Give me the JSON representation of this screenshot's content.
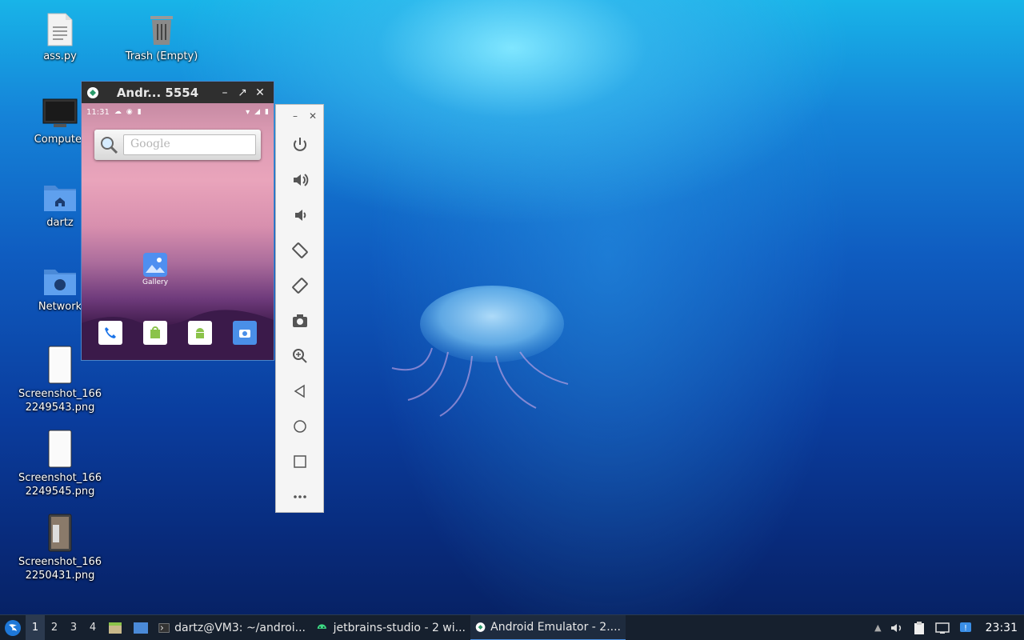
{
  "desktop": {
    "icons": [
      {
        "label": "ass.py"
      },
      {
        "label": "Trash (Empty)"
      },
      {
        "label": "Computer"
      },
      {
        "label": "dartz"
      },
      {
        "label": "Network"
      },
      {
        "label": "Screenshot_166\n2249543.png"
      },
      {
        "label": "Screenshot_166\n2249545.png"
      },
      {
        "label": "Screenshot_166\n2250431.png"
      }
    ]
  },
  "emulator": {
    "title": "Andr... 5554",
    "phone": {
      "time": "11:31",
      "search_placeholder": "Google",
      "apps": [
        {
          "label": "Gallery",
          "icon": "gallery-icon"
        }
      ],
      "dock": [
        "phone-icon",
        "store-icon",
        "android-icon",
        "camera-icon"
      ]
    },
    "toolbar": [
      "power-icon",
      "volume-up-icon",
      "volume-down-icon",
      "rotate-left-icon",
      "rotate-right-icon",
      "screenshot-icon",
      "zoom-icon",
      "back-icon",
      "home-icon",
      "overview-icon",
      "more-icon"
    ]
  },
  "taskbar": {
    "workspaces": [
      "1",
      "2",
      "3",
      "4"
    ],
    "tasks": [
      {
        "label": "dartz@VM3: ~/androi...",
        "icon": "terminal-icon"
      },
      {
        "label": "jetbrains-studio - 2 wi...",
        "icon": "android-icon"
      },
      {
        "label": "Android Emulator - 2....",
        "icon": "emulator-icon"
      }
    ],
    "clock": "23:31"
  },
  "colors": {
    "accent": "#4a90e2",
    "taskbar": "#16202e"
  }
}
